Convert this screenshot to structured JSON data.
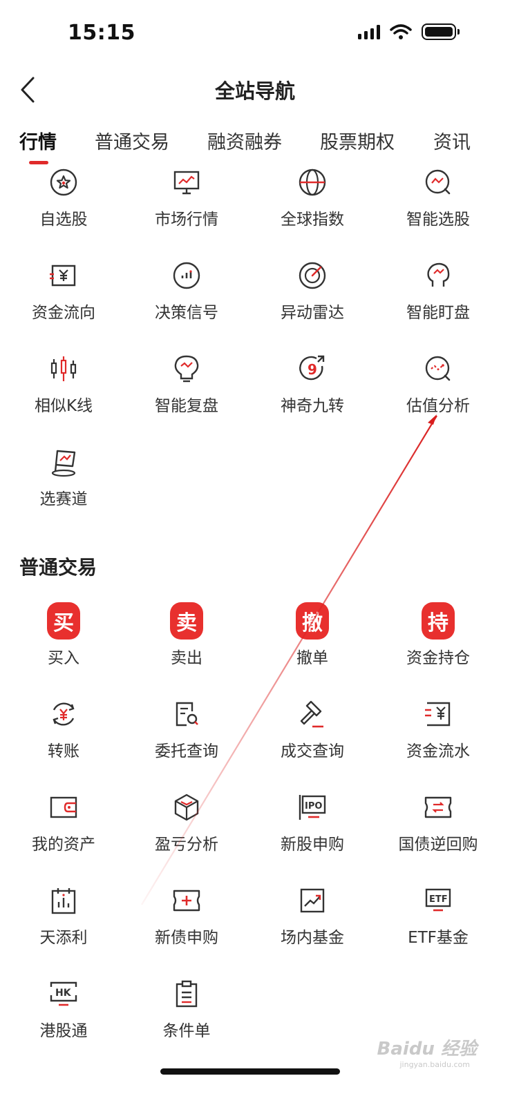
{
  "status_bar": {
    "time": "15:15"
  },
  "nav": {
    "title": "全站导航"
  },
  "tabs": [
    {
      "label": "行情"
    },
    {
      "label": "普通交易"
    },
    {
      "label": "融资融券"
    },
    {
      "label": "股票期权"
    },
    {
      "label": "资讯"
    }
  ],
  "market": {
    "items": [
      {
        "label": "自选股",
        "icon": "star-circle-icon"
      },
      {
        "label": "市场行情",
        "icon": "monitor-chart-icon"
      },
      {
        "label": "全球指数",
        "icon": "globe-icon"
      },
      {
        "label": "智能选股",
        "icon": "smart-pick-icon"
      },
      {
        "label": "资金流向",
        "icon": "fund-flow-icon"
      },
      {
        "label": "决策信号",
        "icon": "signal-bars-icon"
      },
      {
        "label": "异动雷达",
        "icon": "radar-target-icon"
      },
      {
        "label": "智能盯盘",
        "icon": "ai-head-icon"
      },
      {
        "label": "相似K线",
        "icon": "candlestick-icon"
      },
      {
        "label": "智能复盘",
        "icon": "bulb-chart-icon"
      },
      {
        "label": "神奇九转",
        "icon": "nine-turn-icon"
      },
      {
        "label": "估值分析",
        "icon": "valuation-search-icon"
      },
      {
        "label": "选赛道",
        "icon": "flag-track-icon"
      }
    ]
  },
  "trade": {
    "section_title": "普通交易",
    "items": [
      {
        "label": "买入",
        "badge": "买",
        "icon": "buy-badge-icon"
      },
      {
        "label": "卖出",
        "badge": "卖",
        "icon": "sell-badge-icon"
      },
      {
        "label": "撤单",
        "badge": "撤",
        "icon": "cancel-badge-icon"
      },
      {
        "label": "资金持仓",
        "badge": "持",
        "icon": "hold-badge-icon"
      },
      {
        "label": "转账",
        "icon": "transfer-yen-icon"
      },
      {
        "label": "委托查询",
        "icon": "order-search-icon"
      },
      {
        "label": "成交查询",
        "icon": "gavel-icon"
      },
      {
        "label": "资金流水",
        "icon": "ledger-yen-icon"
      },
      {
        "label": "我的资产",
        "icon": "wallet-icon"
      },
      {
        "label": "盈亏分析",
        "icon": "cube-icon"
      },
      {
        "label": "新股申购",
        "icon": "ipo-icon"
      },
      {
        "label": "国债逆回购",
        "icon": "bond-ticket-icon"
      },
      {
        "label": "天添利",
        "icon": "calendar-bars-icon"
      },
      {
        "label": "新债申购",
        "icon": "plus-ticket-icon"
      },
      {
        "label": "场内基金",
        "icon": "trend-box-icon"
      },
      {
        "label": "ETF基金",
        "icon": "etf-icon"
      },
      {
        "label": "港股通",
        "icon": "hk-icon"
      },
      {
        "label": "条件单",
        "icon": "clipboard-icon"
      }
    ]
  },
  "watermark": {
    "brand": "Baidu 经验",
    "url": "jingyan.baidu.com"
  },
  "colors": {
    "accent": "#e02a2a",
    "text": "#333333",
    "icon_stroke": "#333333"
  }
}
